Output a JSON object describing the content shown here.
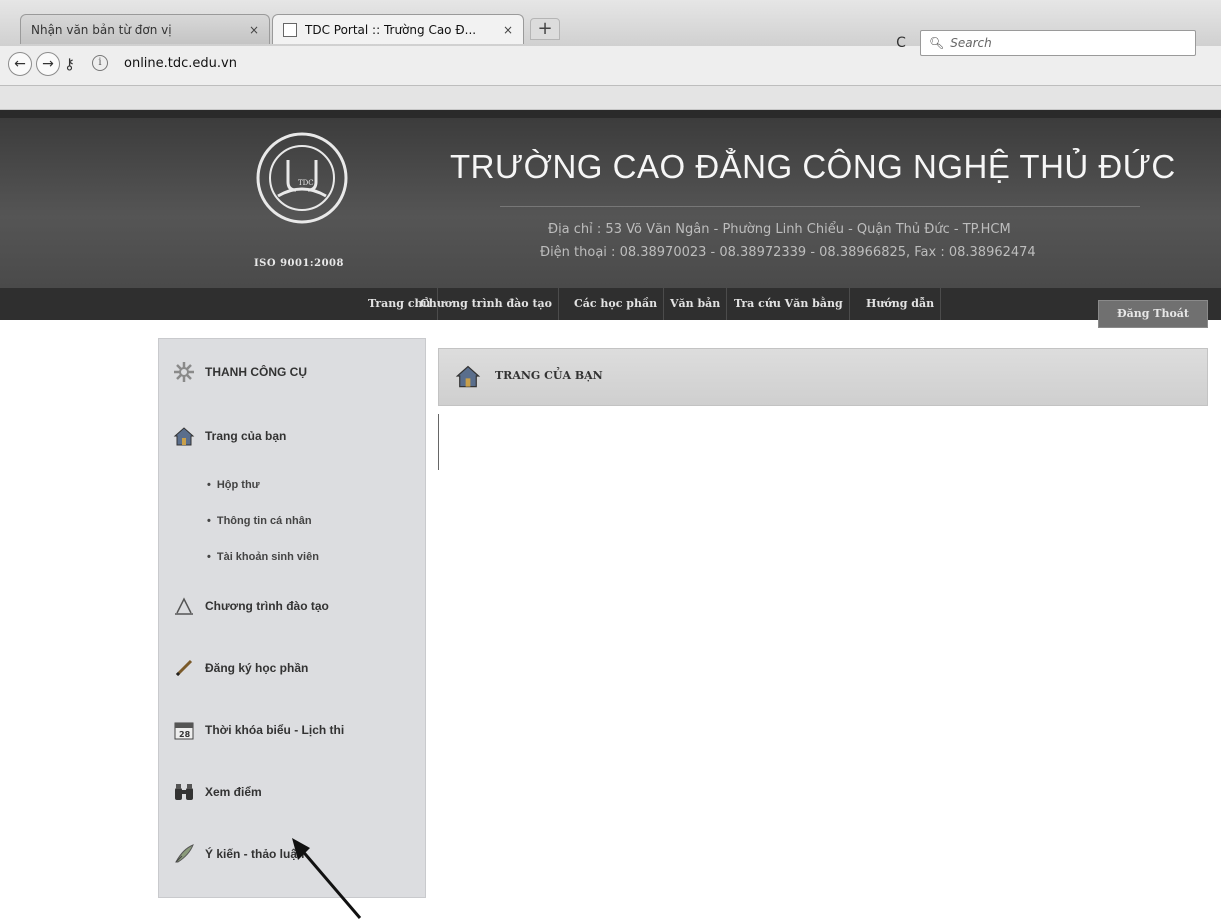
{
  "browser": {
    "tabs": [
      {
        "title": "Nhận văn bản từ đơn vị",
        "close": "×"
      },
      {
        "title": "TDC Portal :: Trường Cao Đ...",
        "close": "×"
      }
    ],
    "new_tab": "+",
    "url_host": "online.tdc.edu.vn",
    "search_placeholder": "Search"
  },
  "header": {
    "school_name": "TRƯỜNG CAO ĐẲNG CÔNG NGHỆ THỦ ĐỨC",
    "address": "Địa chỉ : 53 Võ Văn Ngân - Phường Linh Chiểu - Quận Thủ Đức - TP.HCM",
    "phone": "Điện thoại : 08.38970023 - 08.38972339 - 08.38966825, Fax : 08.38962474",
    "iso": "ISO 9001:2008",
    "logo_text": "TDC"
  },
  "menu": {
    "items": [
      "Trang chủ",
      "Chương trình đào tạo",
      "Các học phần",
      "Văn bản",
      "Tra cứu Văn bằng",
      "Hướng dẫn"
    ],
    "logout": "Đăng Thoát"
  },
  "sidebar": {
    "toolbar_title": "THANH CÔNG CỤ",
    "my_page": "Trang của bạn",
    "sub_items": [
      "Hộp thư",
      "Thông tin cá nhân",
      "Tài khoản sinh viên"
    ],
    "items": [
      "Chương trình đào tạo",
      "Đăng ký học phần",
      "Thời khóa biểu - Lịch thi",
      "Xem điểm",
      "Ý kiến - thảo luận"
    ],
    "calendar_day": "28"
  },
  "main": {
    "title": "TRANG CỦA BẠN"
  },
  "icons": {
    "gear": "gear-icon",
    "house": "house-icon",
    "pen": "pen-icon",
    "calendar": "calendar-icon",
    "binoculars": "binoculars-icon",
    "quill": "quill-icon"
  },
  "colors": {
    "header_bg": "#4a4a4a",
    "menubar_bg": "#2f2f2f",
    "sidebar_bg": "#dcdde0"
  }
}
